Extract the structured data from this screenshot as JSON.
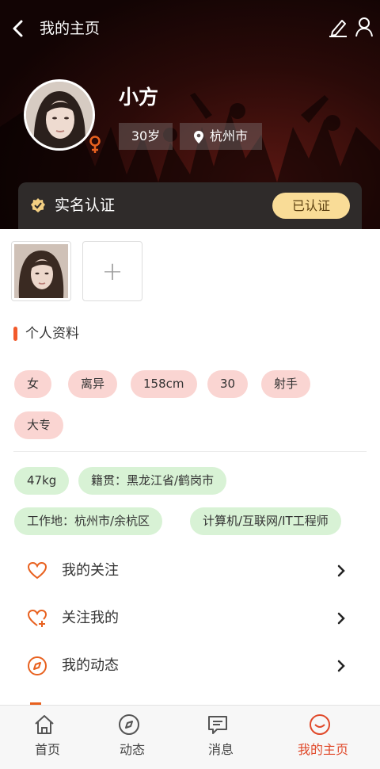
{
  "header": {
    "title": "我的主页"
  },
  "profile": {
    "name": "小方",
    "age": "30岁",
    "city": "杭州市"
  },
  "verification": {
    "label": "实名认证",
    "status": "已认证"
  },
  "photos": {
    "add_symbol": "+"
  },
  "section": {
    "title": "个人资料"
  },
  "tags_pink": [
    "女",
    "离异",
    "158cm",
    "30",
    "射手",
    "大专"
  ],
  "tags_green": [
    "47kg",
    "籍贯：黑龙江省/鹤岗市",
    "工作地：杭州市/余杭区",
    "计算机/互联网/IT工程师"
  ],
  "menu": [
    {
      "label": "我的关注",
      "icon": "heart-icon"
    },
    {
      "label": "关注我的",
      "icon": "heart-plus-icon"
    },
    {
      "label": "我的动态",
      "icon": "compass-icon"
    }
  ],
  "bottom_nav": [
    {
      "label": "首页",
      "icon": "home-icon"
    },
    {
      "label": "动态",
      "icon": "compass-icon"
    },
    {
      "label": "消息",
      "icon": "message-icon"
    },
    {
      "label": "我的主页",
      "icon": "smile-icon",
      "active": true
    }
  ],
  "colors": {
    "accent": "#e0492a",
    "tag_pink": "#fad5d2",
    "tag_green": "#d8f2d5",
    "verify_badge": "#f9dc97"
  }
}
